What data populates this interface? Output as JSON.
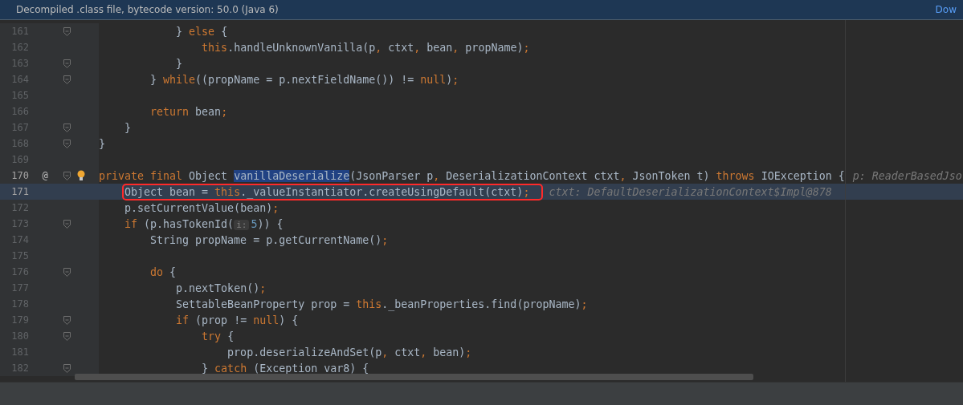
{
  "banner": {
    "text": "Decompiled .class file, bytecode version: 50.0 (Java 6)",
    "link": "Dow"
  },
  "lines": [
    {
      "number": "161",
      "fold": true,
      "tokens": [
        {
          "kind": "plain",
          "t": "            } "
        },
        {
          "kind": "kw",
          "t": "else"
        },
        {
          "kind": "plain",
          "t": " {"
        }
      ]
    },
    {
      "number": "162",
      "fold": false,
      "tokens": [
        {
          "kind": "kw",
          "t": "                this"
        },
        {
          "kind": "plain",
          "t": ".handleUnknownVanilla(p"
        },
        {
          "kind": "kw",
          "t": ","
        },
        {
          "kind": "plain",
          "t": " ctxt"
        },
        {
          "kind": "kw",
          "t": ","
        },
        {
          "kind": "plain",
          "t": " bean"
        },
        {
          "kind": "kw",
          "t": ","
        },
        {
          "kind": "plain",
          "t": " propName)"
        },
        {
          "kind": "kw",
          "t": ";"
        }
      ]
    },
    {
      "number": "163",
      "fold": true,
      "tokens": [
        {
          "kind": "plain",
          "t": "            }"
        }
      ]
    },
    {
      "number": "164",
      "fold": true,
      "tokens": [
        {
          "kind": "plain",
          "t": "        } "
        },
        {
          "kind": "kw",
          "t": "while"
        },
        {
          "kind": "plain",
          "t": "((propName = p.nextFieldName()) != "
        },
        {
          "kind": "kw",
          "t": "null"
        },
        {
          "kind": "plain",
          "t": ")"
        },
        {
          "kind": "kw",
          "t": ";"
        }
      ]
    },
    {
      "number": "165",
      "fold": false
    },
    {
      "number": "166",
      "fold": false,
      "tokens": [
        {
          "kind": "kw",
          "t": "        return"
        },
        {
          "kind": "plain",
          "t": " bean"
        },
        {
          "kind": "kw",
          "t": ";"
        }
      ]
    },
    {
      "number": "167",
      "fold": true,
      "tokens": [
        {
          "kind": "plain",
          "t": "    }"
        }
      ]
    },
    {
      "number": "168",
      "fold": true,
      "tokens": [
        {
          "kind": "plain",
          "t": "}"
        }
      ]
    },
    {
      "number": "169",
      "fold": false
    },
    {
      "number": "170",
      "fold": true,
      "gutter_mark": "@",
      "bulb": true,
      "current": false,
      "tokens": [
        {
          "kind": "kw",
          "t": "private final "
        },
        {
          "kind": "plain",
          "t": "Object "
        },
        {
          "kind": "sel",
          "t": "vanillaDeserialize"
        },
        {
          "kind": "plain",
          "t": "(JsonParser p"
        },
        {
          "kind": "kw",
          "t": ","
        },
        {
          "kind": "plain",
          "t": " DeserializationContext ctxt"
        },
        {
          "kind": "kw",
          "t": ","
        },
        {
          "kind": "plain",
          "t": " JsonToken t) "
        },
        {
          "kind": "kw",
          "t": "throws"
        },
        {
          "kind": "plain",
          "t": " IOException {"
        }
      ],
      "hint": "p: ReaderBasedJso"
    },
    {
      "number": "171",
      "fold": false,
      "current": true,
      "boxed": true,
      "tokens": [
        {
          "kind": "plain",
          "t": "    Object bean = "
        },
        {
          "kind": "kw",
          "t": "this"
        },
        {
          "kind": "plain",
          "t": "._valueInstantiator.createUsingDefault(ctxt)"
        },
        {
          "kind": "kw",
          "t": ";"
        }
      ],
      "hint": "ctxt: DefaultDeserializationContext$Impl@878"
    },
    {
      "number": "172",
      "fold": false,
      "tokens": [
        {
          "kind": "plain",
          "t": "    p.setCurrentValue(bean)"
        },
        {
          "kind": "kw",
          "t": ";"
        }
      ]
    },
    {
      "number": "173",
      "fold": true,
      "tokens": [
        {
          "kind": "kw",
          "t": "    if"
        },
        {
          "kind": "plain",
          "t": " (p.hasTokenId("
        },
        {
          "kind": "param",
          "t": "i:"
        },
        {
          "kind": "num",
          "t": "5"
        },
        {
          "kind": "plain",
          "t": ")) {"
        }
      ]
    },
    {
      "number": "174",
      "fold": false,
      "tokens": [
        {
          "kind": "plain",
          "t": "        String propName = p.getCurrentName()"
        },
        {
          "kind": "kw",
          "t": ";"
        }
      ]
    },
    {
      "number": "175",
      "fold": false
    },
    {
      "number": "176",
      "fold": true,
      "tokens": [
        {
          "kind": "kw",
          "t": "        do"
        },
        {
          "kind": "plain",
          "t": " {"
        }
      ]
    },
    {
      "number": "177",
      "fold": false,
      "tokens": [
        {
          "kind": "plain",
          "t": "            p.nextToken()"
        },
        {
          "kind": "kw",
          "t": ";"
        }
      ]
    },
    {
      "number": "178",
      "fold": false,
      "tokens": [
        {
          "kind": "plain",
          "t": "            SettableBeanProperty prop = "
        },
        {
          "kind": "kw",
          "t": "this"
        },
        {
          "kind": "plain",
          "t": "._beanProperties.find(propName)"
        },
        {
          "kind": "kw",
          "t": ";"
        }
      ]
    },
    {
      "number": "179",
      "fold": true,
      "tokens": [
        {
          "kind": "kw",
          "t": "            if"
        },
        {
          "kind": "plain",
          "t": " (prop != "
        },
        {
          "kind": "kw",
          "t": "null"
        },
        {
          "kind": "plain",
          "t": ") {"
        }
      ]
    },
    {
      "number": "180",
      "fold": true,
      "tokens": [
        {
          "kind": "kw",
          "t": "                try"
        },
        {
          "kind": "plain",
          "t": " {"
        }
      ]
    },
    {
      "number": "181",
      "fold": false,
      "tokens": [
        {
          "kind": "plain",
          "t": "                    prop.deserializeAndSet(p"
        },
        {
          "kind": "kw",
          "t": ","
        },
        {
          "kind": "plain",
          "t": " ctxt"
        },
        {
          "kind": "kw",
          "t": ","
        },
        {
          "kind": "plain",
          "t": " bean)"
        },
        {
          "kind": "kw",
          "t": ";"
        }
      ]
    },
    {
      "number": "182",
      "fold": true,
      "tokens": [
        {
          "kind": "plain",
          "t": "                } "
        },
        {
          "kind": "kw",
          "t": "catch"
        },
        {
          "kind": "plain",
          "t": " (Exception var8) {"
        }
      ]
    }
  ]
}
